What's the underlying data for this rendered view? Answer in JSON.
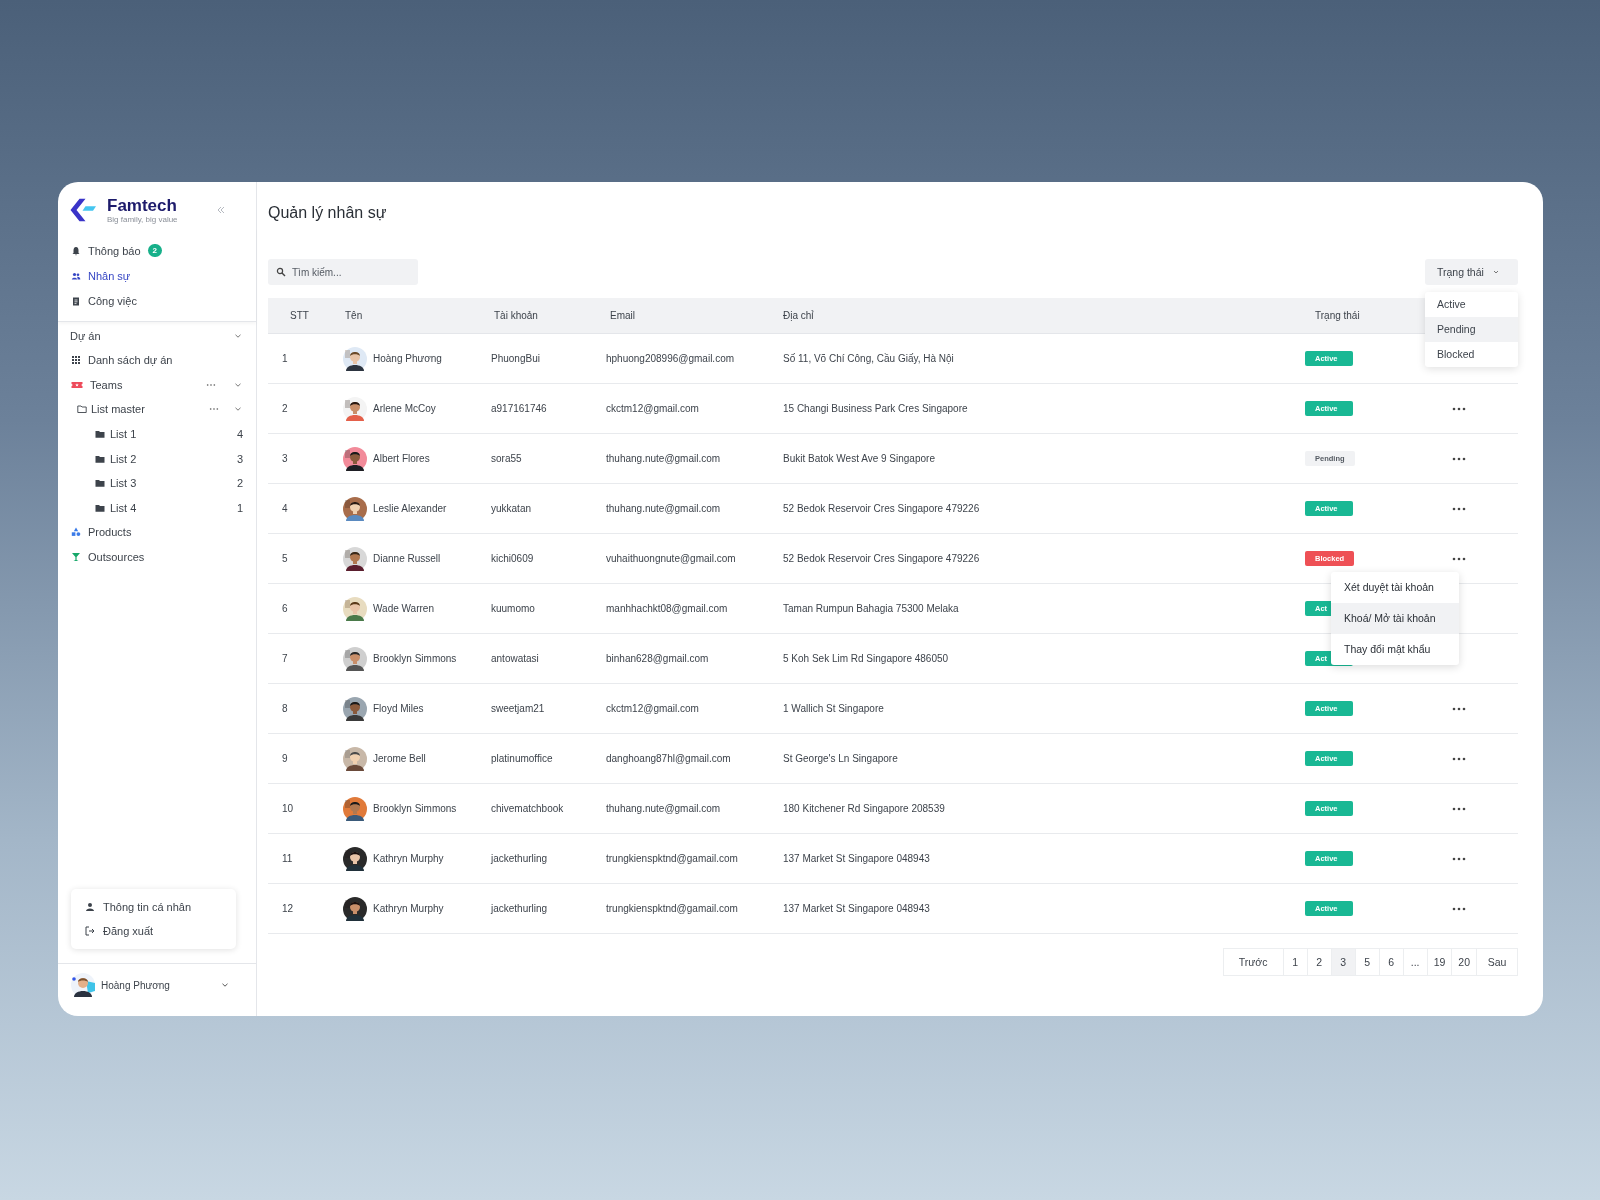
{
  "brand": {
    "name": "Famtech",
    "tagline": "Big family, big value"
  },
  "nav": [
    {
      "label": "Thông báo",
      "badge": "2",
      "selected": false
    },
    {
      "label": "Nhân sự",
      "selected": true
    },
    {
      "label": "Công việc",
      "selected": false
    }
  ],
  "project_section": {
    "label": "Dự án",
    "expanded": true,
    "children": [
      {
        "label": "Danh sách dự án"
      },
      {
        "label": "Teams",
        "expanded": true,
        "children": [
          {
            "label": "List master",
            "expanded": true,
            "children": [
              {
                "label": "List 1",
                "count": "4"
              },
              {
                "label": "List 2",
                "count": "3"
              },
              {
                "label": "List 3",
                "count": "2"
              },
              {
                "label": "List 4",
                "count": "1"
              }
            ]
          }
        ]
      },
      {
        "label": "Products"
      },
      {
        "label": "Outsources"
      }
    ]
  },
  "profile_menu": [
    {
      "label": "Thông tin cá nhân"
    },
    {
      "label": "Đăng xuất"
    }
  ],
  "user": {
    "name": "Hoàng Phương"
  },
  "page": {
    "title": "Quản lý nhân sự"
  },
  "search": {
    "placeholder": "Tìm kiếm..."
  },
  "status_filter": {
    "label": "Trạng thái",
    "expanded": true,
    "options": [
      {
        "label": "Active",
        "selected": false
      },
      {
        "label": "Pending",
        "selected": true
      },
      {
        "label": "Blocked",
        "selected": false
      }
    ]
  },
  "table": {
    "columns": [
      "STT",
      "Tên",
      "Tài khoản",
      "Email",
      "Địa chỉ",
      "Trạng thái"
    ],
    "row_menu": [
      {
        "label": "Xét duyệt tài khoản",
        "selected": false
      },
      {
        "label": "Khoá/ Mở tài khoản",
        "selected": true
      },
      {
        "label": "Thay đổi mật khẩu",
        "selected": false
      }
    ],
    "rows": [
      {
        "no": "1",
        "name": "Hoàng Phương",
        "account": "PhuongBui",
        "email": "hphuong208996@gmail.com",
        "address": "Số 11, Võ Chí Công, Cầu Giấy, Hà Nội",
        "status": "Active",
        "kind": "active",
        "actions_visible": false,
        "menu_open": false
      },
      {
        "no": "2",
        "name": "Arlene McCoy",
        "account": "a917161746",
        "email": "ckctm12@gmail.com",
        "address": "15 Changi Business Park Cres Singapore",
        "status": "Active",
        "kind": "active",
        "actions_visible": true,
        "menu_open": false
      },
      {
        "no": "3",
        "name": "Albert Flores",
        "account": "sora55",
        "email": "thuhang.nute@gmail.com",
        "address": "Bukit Batok West Ave 9 Singapore",
        "status": "Pending",
        "kind": "pending",
        "actions_visible": true,
        "menu_open": false
      },
      {
        "no": "4",
        "name": "Leslie Alexander",
        "account": "yukkatan",
        "email": "thuhang.nute@gmail.com",
        "address": "52 Bedok Reservoir Cres Singapore 479226",
        "status": "Active",
        "kind": "active",
        "actions_visible": true,
        "menu_open": false
      },
      {
        "no": "5",
        "name": "Dianne Russell",
        "account": "kichi0609",
        "email": "vuhaithuongnute@gmail.com",
        "address": "52 Bedok Reservoir Cres Singapore 479226",
        "status": "Blocked",
        "kind": "blocked",
        "actions_visible": true,
        "menu_open": true
      },
      {
        "no": "6",
        "name": "Wade Warren",
        "account": "kuumomo",
        "email": "manhhachkt08@gmail.com",
        "address": "Taman Rumpun Bahagia 75300 Melaka",
        "status": "Act",
        "kind": "active",
        "actions_visible": false,
        "menu_open": false
      },
      {
        "no": "7",
        "name": "Brooklyn Simmons",
        "account": "antowatasi",
        "email": "binhan628@gmail.com",
        "address": "5 Koh Sek Lim Rd Singapore 486050",
        "status": "Act",
        "kind": "active",
        "actions_visible": false,
        "menu_open": false
      },
      {
        "no": "8",
        "name": "Floyd Miles",
        "account": "sweetjam21",
        "email": "ckctm12@gmail.com",
        "address": "1 Wallich St Singapore",
        "status": "Active",
        "kind": "active",
        "actions_visible": true,
        "menu_open": false
      },
      {
        "no": "9",
        "name": "Jerome Bell",
        "account": "platinumoffice",
        "email": "danghoang87hl@gmail.com",
        "address": "St George's Ln Singapore",
        "status": "Active",
        "kind": "active",
        "actions_visible": true,
        "menu_open": false
      },
      {
        "no": "10",
        "name": "Brooklyn Simmons",
        "account": "chivematchbook",
        "email": "thuhang.nute@gmail.com",
        "address": "180 Kitchener Rd Singapore 208539",
        "status": "Active",
        "kind": "active",
        "actions_visible": true,
        "menu_open": false
      },
      {
        "no": "11",
        "name": "Kathryn Murphy",
        "account": "jackethurling",
        "email": "trungkienspktnd@gamail.com",
        "address": "137 Market St Singapore 048943",
        "status": "Active",
        "kind": "active",
        "actions_visible": true,
        "menu_open": false
      },
      {
        "no": "12",
        "name": "Kathryn Murphy",
        "account": "jackethurling",
        "email": "trungkienspktnd@gamail.com",
        "address": "137 Market St Singapore 048943",
        "status": "Active",
        "kind": "active",
        "actions_visible": true,
        "menu_open": false
      }
    ]
  },
  "pagination": [
    {
      "label": "Trước",
      "selected": false
    },
    {
      "label": "1",
      "selected": false
    },
    {
      "label": "2",
      "selected": false
    },
    {
      "label": "3",
      "selected": true
    },
    {
      "label": "5",
      "selected": false
    },
    {
      "label": "6",
      "selected": false
    },
    {
      "label": "...",
      "selected": false
    },
    {
      "label": "19",
      "selected": false
    },
    {
      "label": "20",
      "selected": false
    },
    {
      "label": "Sau",
      "selected": false
    }
  ]
}
